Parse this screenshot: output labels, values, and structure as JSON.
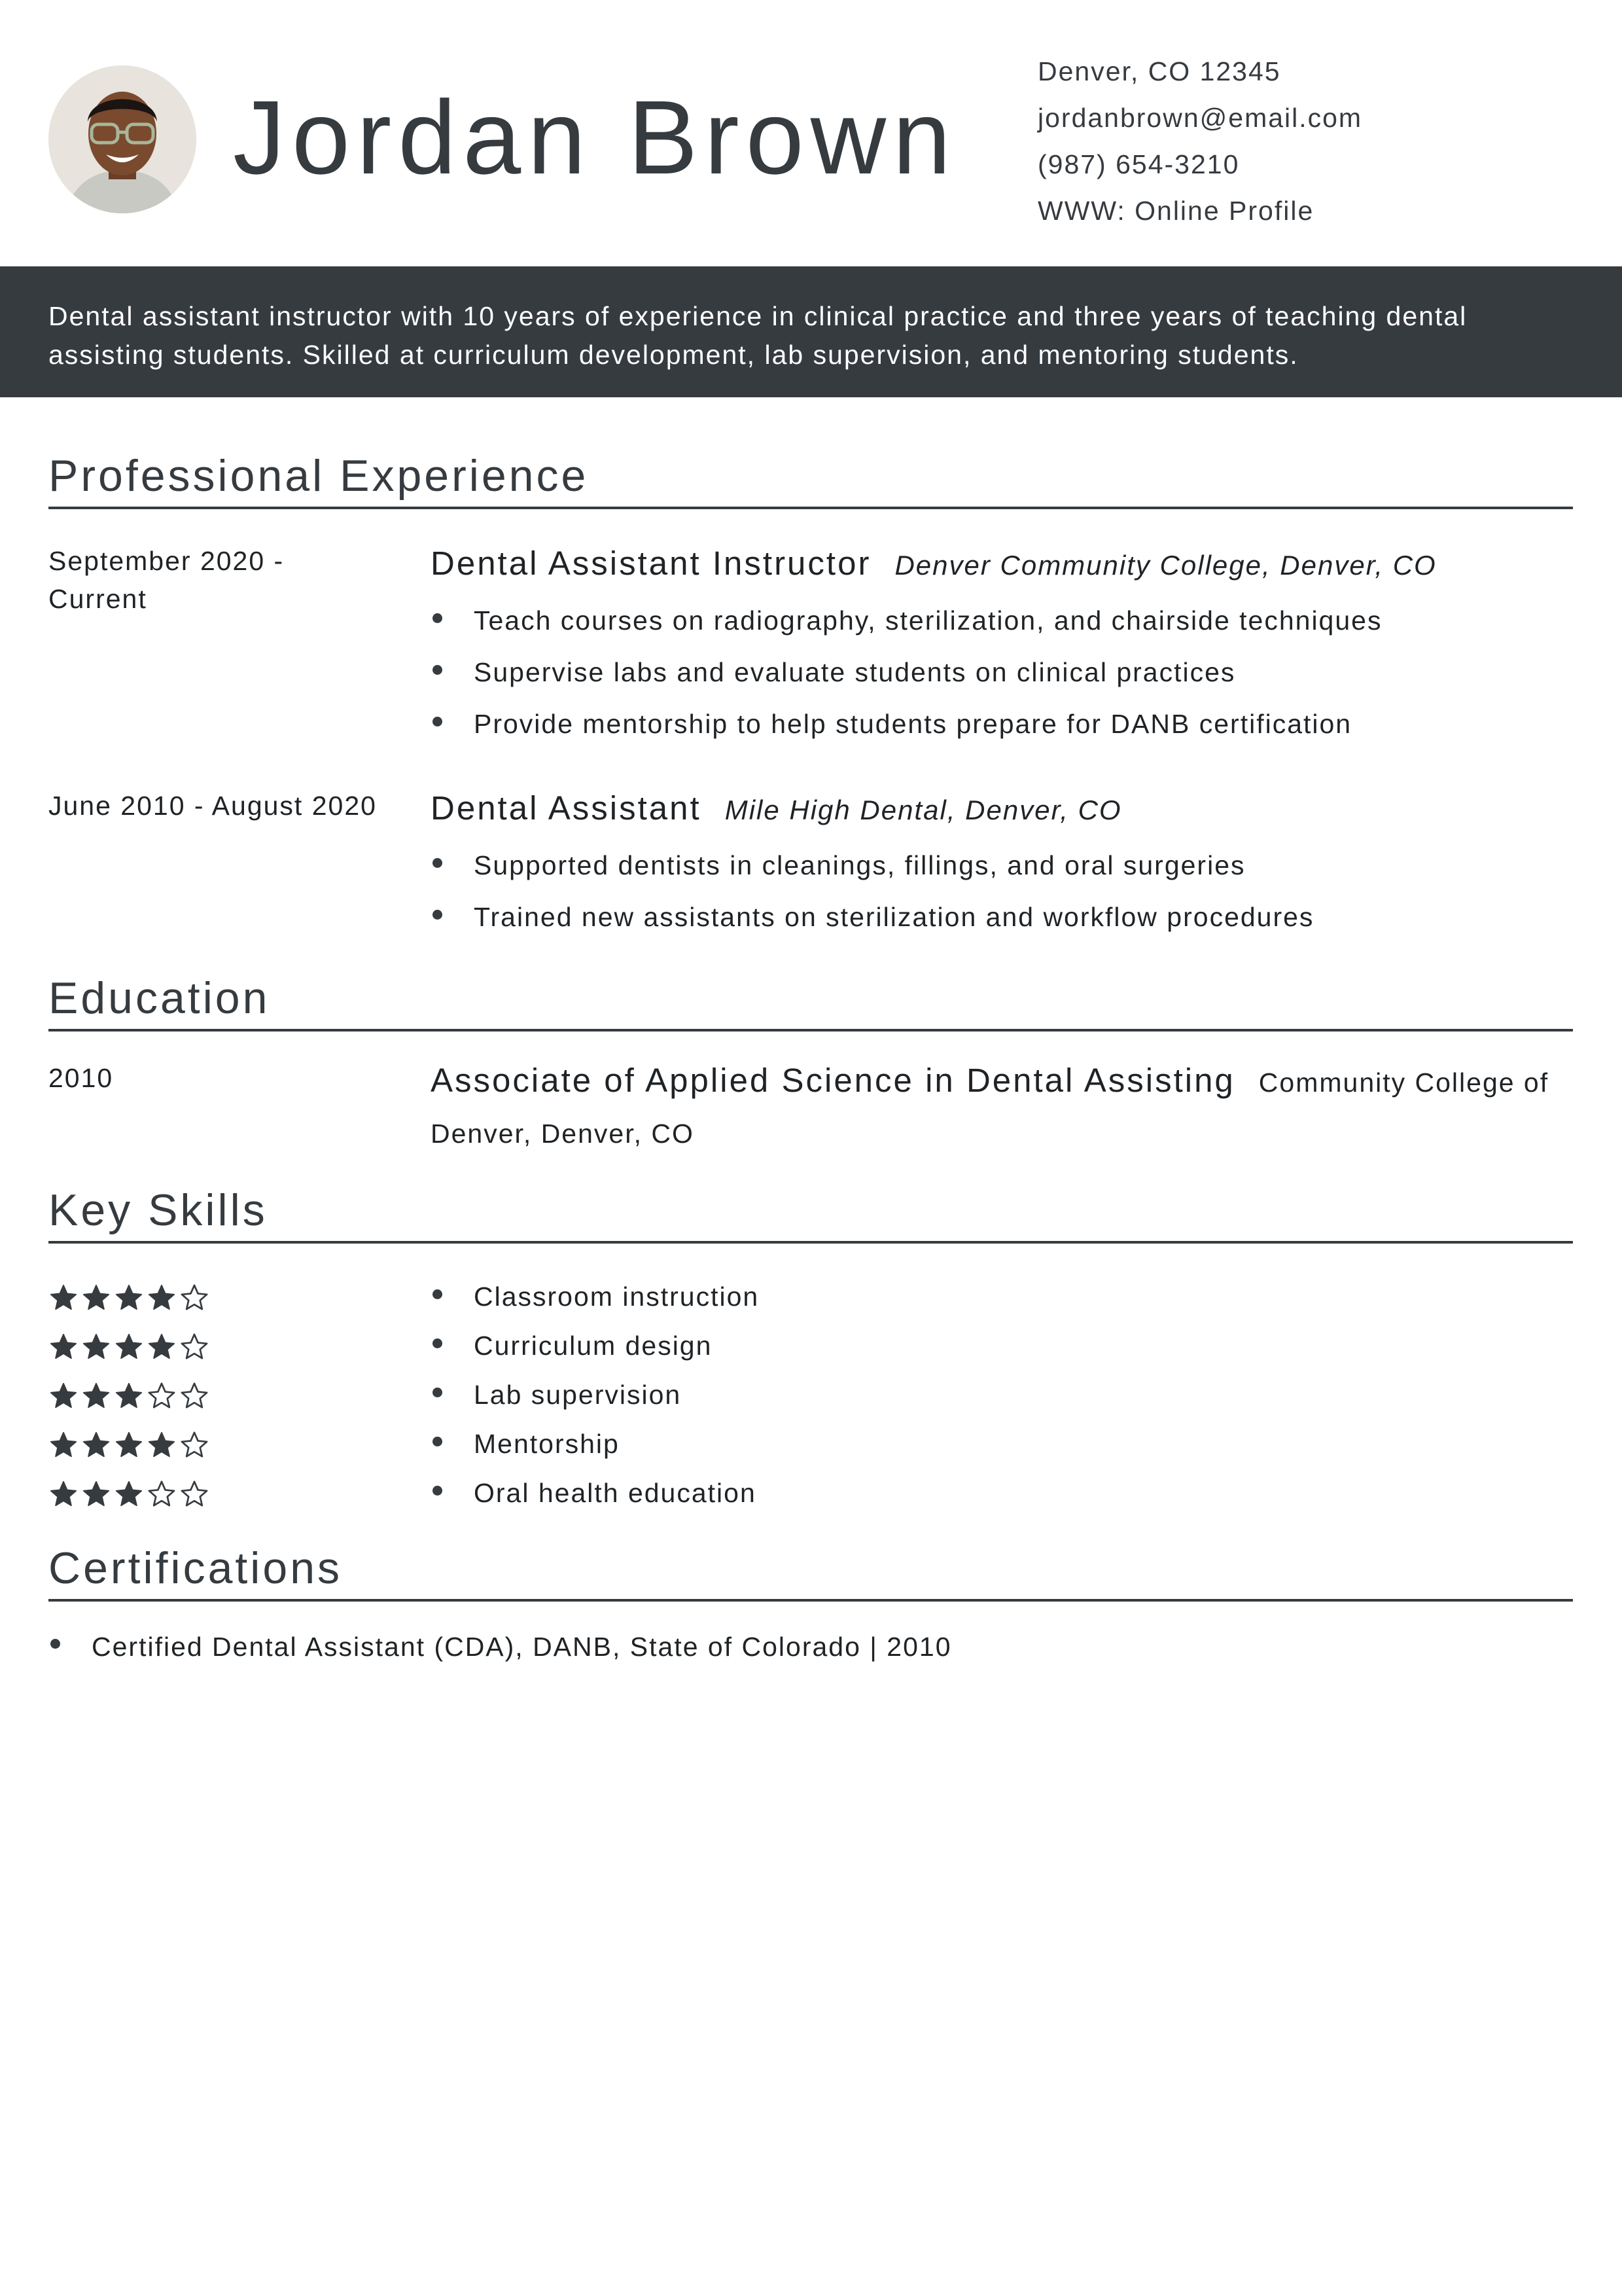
{
  "header": {
    "name": "Jordan Brown",
    "contact": {
      "address": "Denver, CO 12345",
      "email": "jordanbrown@email.com",
      "phone": "(987) 654-3210",
      "website": "WWW: Online Profile"
    }
  },
  "summary": "Dental assistant instructor with 10 years of experience in clinical practice and three years of teaching dental assisting students. Skilled at curriculum development, lab supervision, and mentoring students.",
  "experience": {
    "title": "Professional Experience",
    "jobs": [
      {
        "dates": "September 2020 - Current",
        "role": "Dental Assistant Instructor",
        "org": "Denver Community College, Denver, CO",
        "bullets": [
          "Teach courses on radiography, sterilization, and chairside techniques",
          "Supervise labs and evaluate students on clinical practices",
          "Provide mentorship to help students prepare for DANB certification"
        ]
      },
      {
        "dates": "June 2010 - August 2020",
        "role": "Dental Assistant",
        "org": "Mile High Dental, Denver, CO",
        "bullets": [
          "Supported dentists in cleanings, fillings, and oral surgeries",
          "Trained new assistants on sterilization and workflow procedures"
        ]
      }
    ]
  },
  "education": {
    "title": "Education",
    "items": [
      {
        "year": "2010",
        "degree": "Associate of Applied Science in Dental Assisting",
        "school": "Community College of Denver, Denver, CO"
      }
    ]
  },
  "skills": {
    "title": "Key Skills",
    "items": [
      {
        "name": "Classroom instruction",
        "rating": 4,
        "max": 5
      },
      {
        "name": "Curriculum design",
        "rating": 4,
        "max": 5
      },
      {
        "name": "Lab supervision",
        "rating": 3,
        "max": 5
      },
      {
        "name": "Mentorship",
        "rating": 4,
        "max": 5
      },
      {
        "name": "Oral health education",
        "rating": 3,
        "max": 5
      }
    ]
  },
  "certifications": {
    "title": "Certifications",
    "items": [
      "Certified Dental Assistant (CDA), DANB, State of Colorado | 2010"
    ]
  },
  "colors": {
    "accent": "#363b40",
    "text": "#1f2326",
    "background": "#ffffff"
  },
  "icons": {
    "rating_filled": "star-filled-icon",
    "rating_empty": "star-outline-icon",
    "bullet": "bullet-dot-icon"
  }
}
